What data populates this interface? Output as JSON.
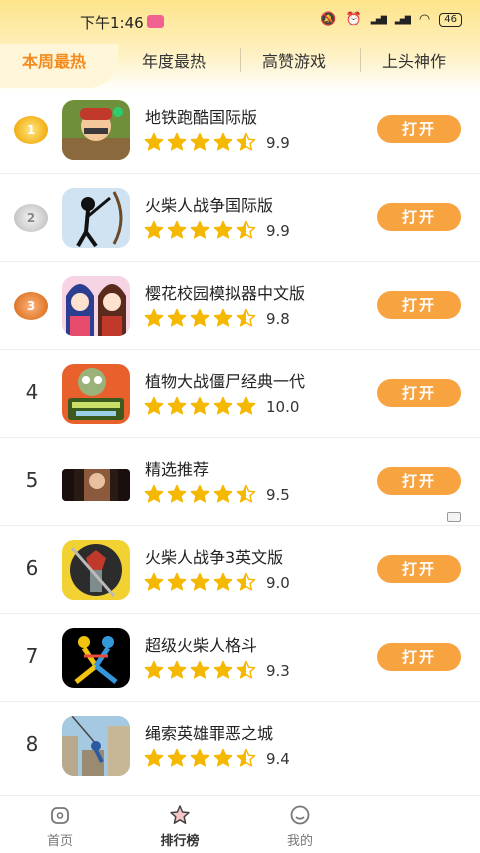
{
  "status_bar": {
    "time": "下午1:46",
    "battery": "46"
  },
  "tabs": [
    {
      "label": "本周最热",
      "active": true
    },
    {
      "label": "年度最热",
      "active": false
    },
    {
      "label": "高赞游戏",
      "active": false
    },
    {
      "label": "上头神作",
      "active": false
    }
  ],
  "games": [
    {
      "rank": "1",
      "medal": "gold",
      "name": "地铁跑酷国际版",
      "rating": 4.5,
      "score": "9.9",
      "button": "打开"
    },
    {
      "rank": "2",
      "medal": "silver",
      "name": "火柴人战争国际版",
      "rating": 4.5,
      "score": "9.9",
      "button": "打开"
    },
    {
      "rank": "3",
      "medal": "bronze",
      "name": "樱花校园模拟器中文版",
      "rating": 4.5,
      "score": "9.8",
      "button": "打开"
    },
    {
      "rank": "4",
      "name": "植物大战僵尸经典一代",
      "rating": 5,
      "score": "10.0",
      "button": "打开"
    },
    {
      "rank": "5",
      "name": "精选推荐",
      "rating": 4.5,
      "score": "9.5",
      "button": "打开"
    },
    {
      "rank": "6",
      "name": "火柴人战争3英文版",
      "rating": 4.5,
      "score": "9.0",
      "button": "打开"
    },
    {
      "rank": "7",
      "name": "超级火柴人格斗",
      "rating": 4.5,
      "score": "9.3",
      "button": "打开"
    },
    {
      "rank": "8",
      "name": "绳索英雄罪恶之城",
      "rating": 4.5,
      "score": "9.4",
      "button": ""
    }
  ],
  "bottom_nav": [
    {
      "label": "首页",
      "icon": "home-icon",
      "active": false
    },
    {
      "label": "排行榜",
      "icon": "star-icon",
      "active": true
    },
    {
      "label": "我的",
      "icon": "profile-icon",
      "active": false
    }
  ],
  "colors": {
    "accent": "#f7a340",
    "star": "#f5b800",
    "active_tab": "#f28c1e"
  }
}
